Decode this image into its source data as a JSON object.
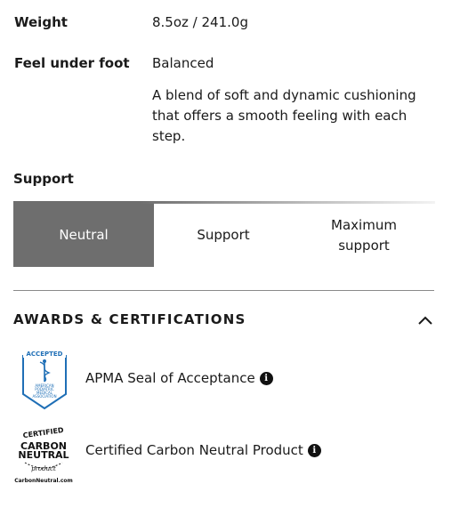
{
  "specs": {
    "weight_label": "Weight",
    "weight_value": "8.5oz / 241.0g",
    "feel_label": "Feel under foot",
    "feel_value": "Balanced",
    "feel_description": "A blend of soft and dynamic cushioning that offers a smooth feeling with each step."
  },
  "support": {
    "title": "Support",
    "options": [
      "Neutral",
      "Support",
      "Maximum support"
    ],
    "selected": "Neutral"
  },
  "awards": {
    "title": "AWARDS & CERTIFICATIONS",
    "items": [
      {
        "label": "APMA Seal of Acceptance",
        "badge_text_top": "ACCEPTED",
        "badge_text_lines": [
          "AMERICAN",
          "PODIATRIC",
          "MEDICAL",
          "ASSOCIATION"
        ]
      },
      {
        "label": "Certified Carbon Neutral Product",
        "badge_text_lines": [
          "CERTIFIED",
          "CARBON",
          "NEUTRAL",
          "product",
          "CarbonNeutral.com"
        ]
      }
    ]
  },
  "colors": {
    "selected_segment": "#6e6e6e",
    "apma_blue": "#1f6fb6",
    "text": "#1a1a1a"
  },
  "icons": {
    "chevron": "chevron-up-icon",
    "info": "info-icon"
  }
}
